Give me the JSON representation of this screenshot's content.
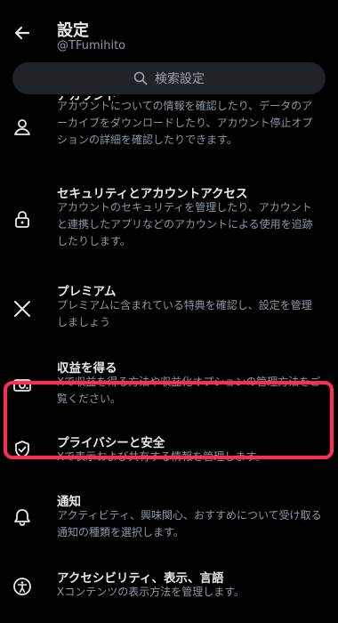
{
  "header": {
    "title": "設定",
    "handle": "@TFumihito"
  },
  "search": {
    "placeholder": "検索設定"
  },
  "items": [
    {
      "name": "アカウント",
      "desc": "アカウントについての情報を確認したり、データのアーカイブをダウンロードしたり、アカウント停止オプションの詳細を確認したりできます。",
      "icon": "person-icon"
    },
    {
      "name": "セキュリティとアカウントアクセス",
      "desc": "アカウントのセキュリティを管理したり、アカウントと連携したアプリなどのアカウントによる使用を追跡したりします。",
      "icon": "lock-icon"
    },
    {
      "name": "プレミアム",
      "desc": "プレミアムに含まれている特典を確認し、設定を管理しましょう",
      "icon": "x-logo-icon"
    },
    {
      "name": "収益を得る",
      "desc": "Xで収益を得る方法や収益化オプションの管理方法をご覧ください。",
      "icon": "money-icon"
    },
    {
      "name": "プライバシーと安全",
      "desc": "Xで表示および共有する情報を管理します。",
      "icon": "shield-check-icon"
    },
    {
      "name": "通知",
      "desc": "アクティビティ、興味関心、おすすめについて受け取る通知の種類を選択します。",
      "icon": "bell-icon"
    },
    {
      "name": "アクセシビリティ、表示、言語",
      "desc": "Xコンテンツの表示方法を管理します。",
      "icon": "accessibility-icon"
    }
  ],
  "colors": {
    "background": "#000000",
    "text": "#e7e9ea",
    "secondary_text": "#8b98a5",
    "search_bg": "#202327",
    "highlight": "#ff2d55"
  }
}
